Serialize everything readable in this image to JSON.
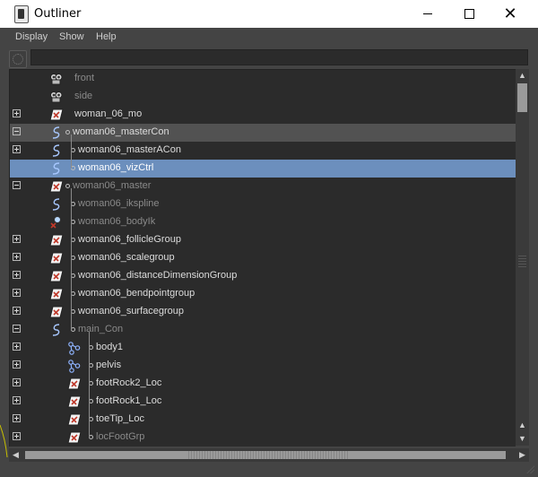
{
  "window": {
    "title": "Outliner",
    "controls": [
      "minimize-icon",
      "maximize-icon",
      "close-icon"
    ]
  },
  "menu": [
    "Display",
    "Show",
    "Help"
  ],
  "search": {
    "value": "",
    "placeholder": ""
  },
  "colors": {
    "panel_bg": "#444444",
    "tree_bg": "#2b2b2b",
    "selection": "#6c8fbd",
    "highlight": "#525252",
    "text": "#dcdcdc",
    "dim_text": "#8a8a8a",
    "locator_icon_red": "#c0392b",
    "curve_icon_blue": "#a8c8ff"
  },
  "tree": [
    {
      "label": "front",
      "icon": "camera-icon",
      "indent": 0,
      "expander": "none",
      "state": "dim"
    },
    {
      "label": "side",
      "icon": "camera-icon",
      "indent": 0,
      "expander": "none",
      "state": "dim"
    },
    {
      "label": "woman_06_mo",
      "icon": "transform-icon",
      "indent": 0,
      "expander": "plus",
      "state": "normal"
    },
    {
      "label": "woman06_masterCon",
      "icon": "curve-icon",
      "indent": 0,
      "expander": "minus",
      "state": "highlight"
    },
    {
      "label": "woman06_masterACon",
      "icon": "curve-icon",
      "indent": 1,
      "expander": "plus",
      "state": "normal"
    },
    {
      "label": "woman06_vizCtrl",
      "icon": "curve-icon",
      "indent": 1,
      "expander": "none",
      "state": "selected"
    },
    {
      "label": "woman06_master",
      "icon": "transform-icon",
      "indent": 0,
      "expander": "minus",
      "state": "dim"
    },
    {
      "label": "woman06_ikspline",
      "icon": "curve-icon",
      "indent": 1,
      "expander": "none",
      "state": "dim"
    },
    {
      "label": "woman06_bodyIk",
      "icon": "ik-handle-icon",
      "indent": 1,
      "expander": "none",
      "state": "dim"
    },
    {
      "label": "woman06_follicleGroup",
      "icon": "transform-icon",
      "indent": 1,
      "expander": "plus",
      "state": "normal"
    },
    {
      "label": "woman06_scalegroup",
      "icon": "transform-icon",
      "indent": 1,
      "expander": "plus",
      "state": "normal"
    },
    {
      "label": "woman06_distanceDimensionGroup",
      "icon": "transform-icon",
      "indent": 1,
      "expander": "plus",
      "state": "normal"
    },
    {
      "label": "woman06_bendpointgroup",
      "icon": "transform-icon",
      "indent": 1,
      "expander": "plus",
      "state": "normal"
    },
    {
      "label": "woman06_surfacegroup",
      "icon": "transform-icon",
      "indent": 1,
      "expander": "plus",
      "state": "normal"
    },
    {
      "label": "main_Con",
      "icon": "curve-icon",
      "indent": 1,
      "expander": "minus",
      "state": "dim"
    },
    {
      "label": "body1",
      "icon": "joint-icon",
      "indent": 2,
      "expander": "plus",
      "state": "normal"
    },
    {
      "label": "pelvis",
      "icon": "joint-icon",
      "indent": 2,
      "expander": "plus",
      "state": "normal"
    },
    {
      "label": "footRock2_Loc",
      "icon": "transform-icon",
      "indent": 2,
      "expander": "plus",
      "state": "normal"
    },
    {
      "label": "footRock1_Loc",
      "icon": "transform-icon",
      "indent": 2,
      "expander": "plus",
      "state": "normal"
    },
    {
      "label": "toeTip_Loc",
      "icon": "transform-icon",
      "indent": 2,
      "expander": "plus",
      "state": "normal"
    },
    {
      "label": "locFootGrp",
      "icon": "transform-icon",
      "indent": 2,
      "expander": "plus",
      "state": "dim"
    }
  ]
}
